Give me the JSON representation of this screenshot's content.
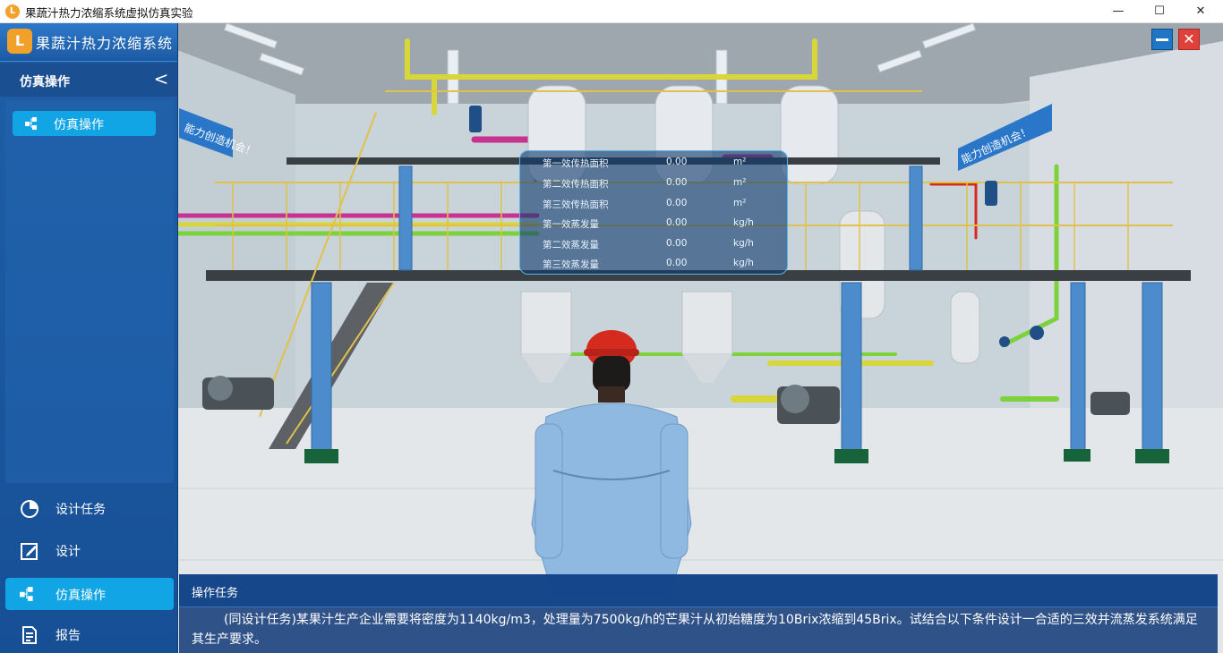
{
  "window": {
    "title": "果蔬汁热力浓缩系统虚拟仿真实验",
    "icon": "app-logo-icon",
    "min_glyph": "—",
    "max_glyph": "☐",
    "close_glyph": "✕"
  },
  "sidebar": {
    "logo_text": "果蔬汁热力浓缩系统",
    "section_title": "仿真操作",
    "collapse_glyph": "<",
    "sub_item": {
      "label": "仿真操作",
      "icon": "flow-icon"
    },
    "nav": [
      {
        "label": "设计任务",
        "icon": "pie-chart-icon",
        "active": false
      },
      {
        "label": "设计",
        "icon": "edit-icon",
        "active": false
      },
      {
        "label": "仿真操作",
        "icon": "flow-icon",
        "active": true
      },
      {
        "label": "报告",
        "icon": "document-icon",
        "active": false
      }
    ]
  },
  "overlay": {
    "close_glyph": "✕"
  },
  "data_panel": {
    "rows": [
      {
        "label": "第一效传热面积",
        "value": "0.00",
        "unit": "m²"
      },
      {
        "label": "第二效传热面积",
        "value": "0.00",
        "unit": "m²"
      },
      {
        "label": "第三效传热面积",
        "value": "0.00",
        "unit": "m²"
      },
      {
        "label": "第一效蒸发量",
        "value": "0.00",
        "unit": "kg/h"
      },
      {
        "label": "第二效蒸发量",
        "value": "0.00",
        "unit": "kg/h"
      },
      {
        "label": "第三效蒸发量",
        "value": "0.00",
        "unit": "kg/h"
      }
    ]
  },
  "scene": {
    "wall_slogan_left": "能力创造机会！",
    "wall_slogan_right": "能力创造机会！"
  },
  "task": {
    "title": "操作任务",
    "text": "(同设计任务)某果汁生产企业需要将密度为1140kg/m3，处理量为7500kg/h的芒果汁从初始糖度为10Brix浓缩到45Brix。试结合以下条件设计一合适的三效并流蒸发系统满足其生产要求。"
  },
  "colors": {
    "sidebar_bg": "#1f5fa8",
    "accent_active": "#11a5e6",
    "pipe_yellow": "#d9d63a",
    "pipe_magenta": "#c8338f",
    "pipe_green": "#7bd23a",
    "hardhat_red": "#d52b1e",
    "close_red": "#e0403a"
  }
}
